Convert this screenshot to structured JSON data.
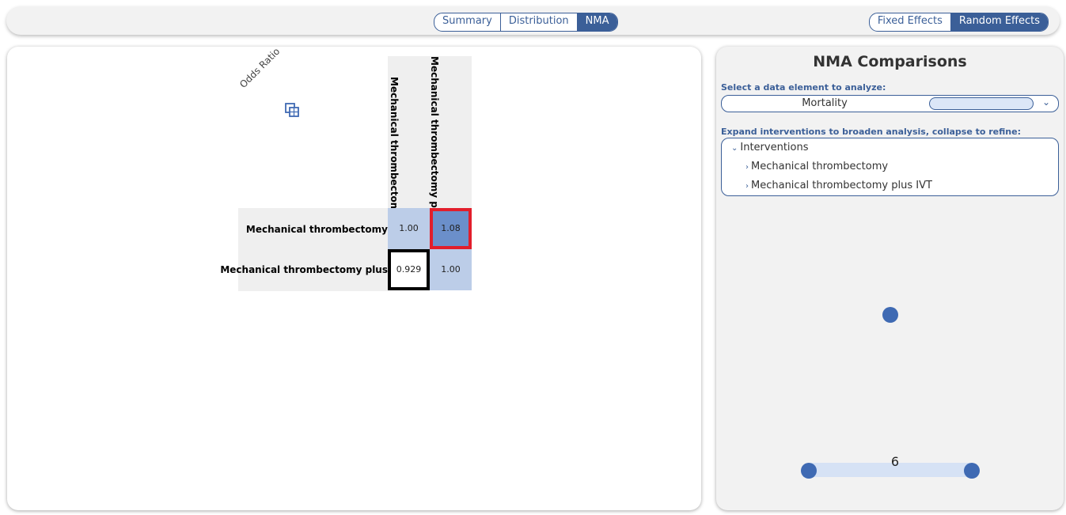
{
  "header": {
    "view_tabs": [
      {
        "label": "Summary",
        "active": false
      },
      {
        "label": "Distribution",
        "active": false
      },
      {
        "label": "NMA",
        "active": true
      }
    ],
    "effect_tabs": [
      {
        "label": "Fixed Effects",
        "active": false
      },
      {
        "label": "Random Effects",
        "active": true
      }
    ]
  },
  "matrix": {
    "metric_label": "Odds Ratio",
    "copy_icon": "copy-icon",
    "columns": [
      "Mechanical thrombectomy",
      "Mechanical thrombectomy pl..."
    ],
    "rows": [
      {
        "label": "Mechanical thrombectomy",
        "values": [
          "1.00",
          "1.08"
        ]
      },
      {
        "label": "Mechanical thrombectomy plus",
        "values": [
          "0.929",
          "1.00"
        ]
      }
    ],
    "colors": {
      "diag": "#bccde8",
      "high": "#6b8fca",
      "highlight_red": "#e21e2b",
      "highlight_black": "#000000"
    }
  },
  "comparisons": {
    "title": "NMA Comparisons",
    "select_label": "Select a data element to analyze:",
    "select_value": "Mortality",
    "expand_label": "Expand interventions to broaden analysis, collapse to refine:",
    "tree": {
      "root": "Interventions",
      "children": [
        "Mechanical thrombectomy",
        "Mechanical thrombectomy plus IVT"
      ]
    },
    "network": {
      "edge_label": "6",
      "node_color": "#3f6ab3",
      "edge_color": "#d6e2f5"
    }
  }
}
